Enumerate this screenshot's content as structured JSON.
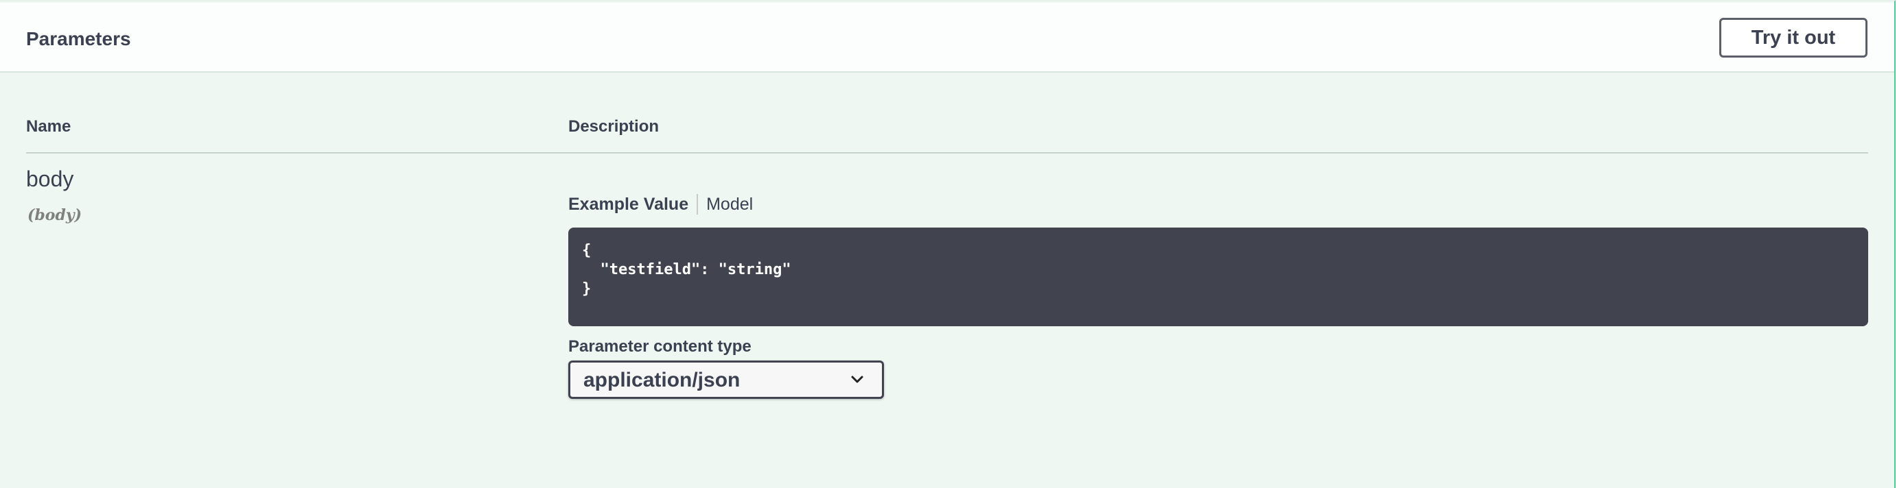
{
  "section": {
    "title": "Parameters",
    "try_button_label": "Try it out"
  },
  "table": {
    "headers": {
      "name": "Name",
      "description": "Description"
    },
    "rows": [
      {
        "name": "body",
        "in": "(body)",
        "tabs": [
          "Example Value",
          "Model"
        ],
        "example_value": "{\n  \"testfield\": \"string\"\n}",
        "content_type_label": "Parameter content type",
        "content_type_selected": "application/json"
      }
    ]
  },
  "icons": {
    "select_arrow": "chevron-down-icon"
  },
  "colors": {
    "accent": "#49cc90",
    "panel_background": "#eef7f1",
    "code_background": "#41444e",
    "text": "#3b4151"
  }
}
